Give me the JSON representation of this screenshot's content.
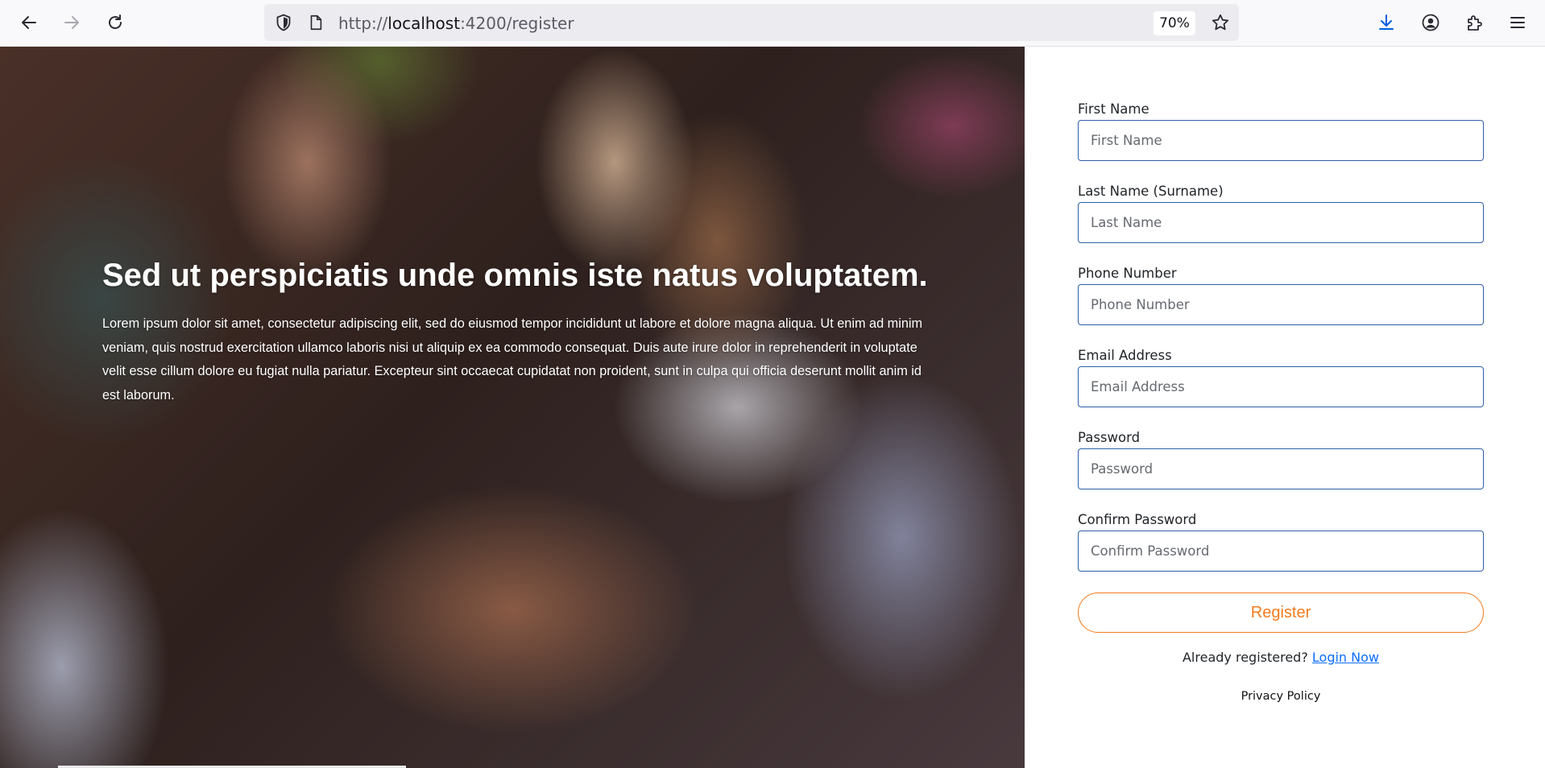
{
  "browser": {
    "url_prefix": "http://",
    "url_host": "localhost",
    "url_rest": ":4200/register",
    "zoom": "70%",
    "icons": {
      "back": "arrow-left-icon",
      "forward": "arrow-right-icon",
      "reload": "reload-icon",
      "tracking": "shield-icon",
      "page": "page-icon",
      "bookmark": "star-icon",
      "downloads": "download-icon",
      "account": "account-icon",
      "extensions": "puzzle-icon",
      "menu": "hamburger-icon"
    },
    "accent_color": "#0060df"
  },
  "hero": {
    "title": "Sed ut perspiciatis unde omnis iste natus voluptatem.",
    "body": "Lorem ipsum dolor sit amet, consectetur adipiscing elit, sed do eiusmod tempor incididunt ut labore et dolore magna aliqua. Ut enim ad minim veniam, quis nostrud exercitation ullamco laboris nisi ut aliquip ex ea commodo consequat. Duis aute irure dolor in reprehenderit in voluptate velit esse cillum dolore eu fugiat nulla pariatur. Excepteur sint occaecat cupidatat non proident, sunt in culpa qui officia deserunt mollit anim id est laborum."
  },
  "form": {
    "fields": [
      {
        "label": "First Name",
        "placeholder": "First Name",
        "value": ""
      },
      {
        "label": "Last Name (Surname)",
        "placeholder": "Last Name",
        "value": ""
      },
      {
        "label": "Phone Number",
        "placeholder": "Phone Number",
        "value": ""
      },
      {
        "label": "Email Address",
        "placeholder": "Email Address",
        "value": ""
      },
      {
        "label": "Password",
        "placeholder": "Password",
        "value": ""
      },
      {
        "label": "Confirm Password",
        "placeholder": "Confirm Password",
        "value": ""
      }
    ],
    "submit_label": "Register",
    "already_text": "Already registered?",
    "login_link": "Login Now",
    "privacy_link": "Privacy Policy",
    "colors": {
      "input_border": "#2f5faa",
      "button": "#f27c1f",
      "link": "#0d6efd"
    }
  }
}
